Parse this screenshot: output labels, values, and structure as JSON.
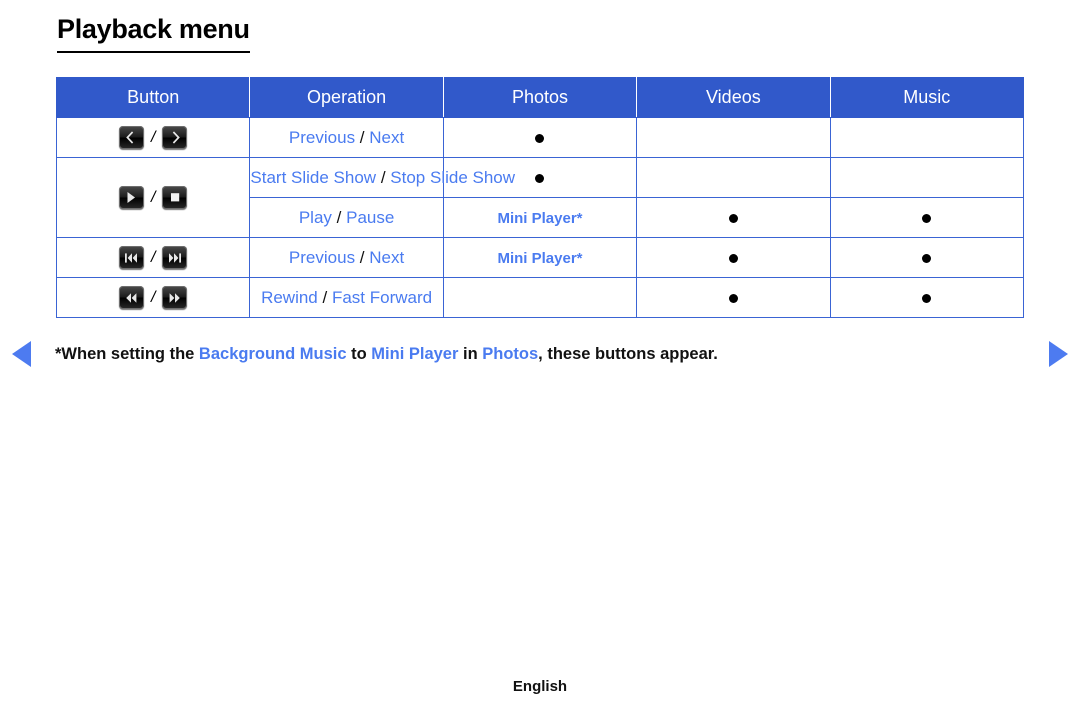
{
  "page": {
    "title": "Playback menu",
    "footer_language": "English"
  },
  "colors": {
    "header_blue": "#3159ca",
    "border_blue": "#3a64d4",
    "link_blue": "#4a7bf0",
    "arrow_blue": "#4d7bf0",
    "text_black": "#111111"
  },
  "table": {
    "headers": [
      {
        "label": "Button"
      },
      {
        "label": "Operation"
      },
      {
        "label": "Photos"
      },
      {
        "label": "Videos"
      },
      {
        "label": "Music"
      }
    ],
    "rows": [
      {
        "buttons": {
          "left_icon": "chevron-left-icon",
          "separator": "/",
          "right_icon": "chevron-right-icon"
        },
        "operation": {
          "left": "Previous",
          "separator": "/",
          "right": "Next"
        },
        "photos": "●",
        "videos": "",
        "music": ""
      },
      {
        "buttons": {
          "left_icon": "play-icon",
          "separator": "/",
          "right_icon": "stop-icon"
        },
        "operation": {
          "left": "Start Slide Show",
          "separator": "/",
          "right": "Stop Slide Show"
        },
        "photos": "●",
        "videos": "",
        "music": ""
      },
      {
        "buttons": null,
        "operation": {
          "left": "Play",
          "separator": "/",
          "right": "Pause"
        },
        "photos": "Mini Player*",
        "videos": "●",
        "music": "●"
      },
      {
        "buttons": {
          "left_icon": "skip-previous-icon",
          "separator": "/",
          "right_icon": "skip-next-icon"
        },
        "operation": {
          "left": "Previous",
          "separator": "/",
          "right": "Next"
        },
        "photos": "Mini Player*",
        "videos": "●",
        "music": "●"
      },
      {
        "buttons": {
          "left_icon": "rewind-icon",
          "separator": "/",
          "right_icon": "fast-forward-icon"
        },
        "operation": {
          "left": "Rewind",
          "separator": "/",
          "right": "Fast Forward"
        },
        "photos": "",
        "videos": "●",
        "music": "●"
      }
    ]
  },
  "footnote": {
    "part1": "*When setting the ",
    "term1": "Background Music",
    "part2": " to ",
    "term2": "Mini Player",
    "part3": " in ",
    "term3": "Photos",
    "part4": ", these buttons appear."
  },
  "navigation": {
    "previous_page_icon": "triangle-left-icon",
    "next_page_icon": "triangle-right-icon"
  }
}
